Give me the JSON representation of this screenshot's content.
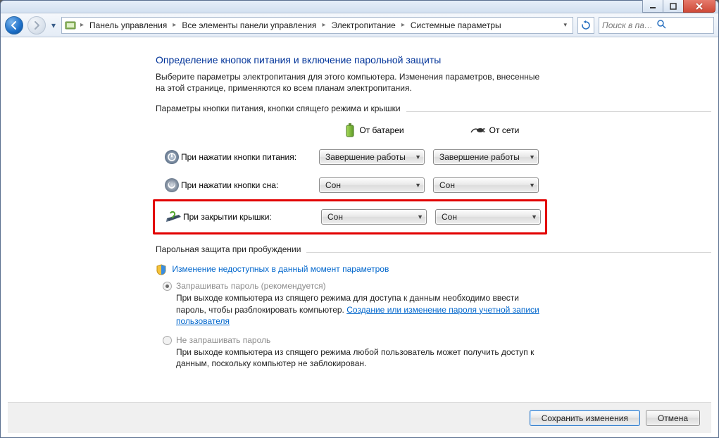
{
  "breadcrumb": {
    "parts": [
      "Панель управления",
      "Все элементы панели управления",
      "Электропитание",
      "Системные параметры"
    ]
  },
  "search": {
    "placeholder": "Поиск в панели упра..."
  },
  "heading": "Определение кнопок питания и включение парольной защиты",
  "description": "Выберите параметры электропитания для этого компьютера. Изменения параметров, внесенные на этой странице, применяются ко всем планам электропитания.",
  "group1": {
    "title": "Параметры кнопки питания, кнопки спящего режима и крышки",
    "col_battery": "От батареи",
    "col_ac": "От сети",
    "rows": [
      {
        "label": "При нажатии кнопки питания:",
        "battery": "Завершение работы",
        "ac": "Завершение работы"
      },
      {
        "label": "При нажатии кнопки сна:",
        "battery": "Сон",
        "ac": "Сон"
      },
      {
        "label": "При закрытии крышки:",
        "battery": "Сон",
        "ac": "Сон"
      }
    ]
  },
  "group2": {
    "title": "Парольная защита при пробуждении",
    "change_link": "Изменение недоступных в данный момент параметров",
    "opt1": {
      "label": "Запрашивать пароль (рекомендуется)",
      "desc_before": "При выходе компьютера из спящего режима для доступа к данным необходимо ввести пароль, чтобы разблокировать компьютер. ",
      "desc_link": "Создание или изменение пароля учетной записи пользователя"
    },
    "opt2": {
      "label": "Не запрашивать пароль",
      "desc": "При выходе компьютера из спящего режима любой пользователь может получить доступ к данным, поскольку компьютер не заблокирован."
    }
  },
  "buttons": {
    "save": "Сохранить изменения",
    "cancel": "Отмена"
  }
}
